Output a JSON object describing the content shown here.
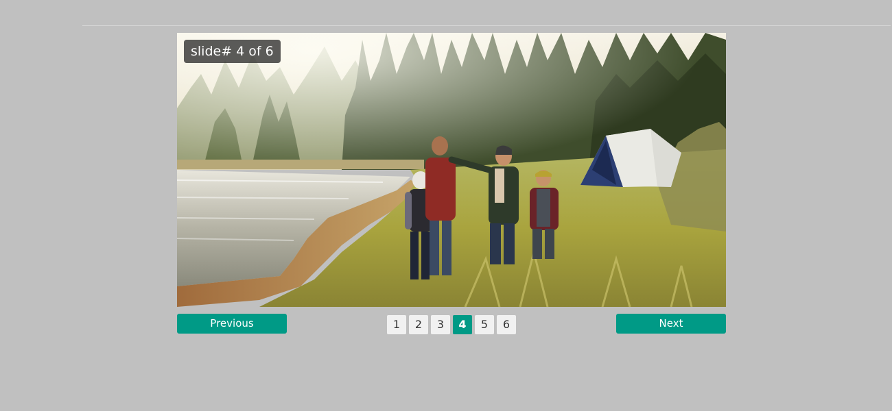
{
  "colors": {
    "accent": "#009a86",
    "page_bg": "#c0c0c0",
    "counter_bg": "#2d2d2d",
    "page_button_bg": "#f1f1f1"
  },
  "slideshow": {
    "counter": "slide# 4 of 6",
    "current_page": 4,
    "image_subject": "family-hiking-by-lake-with-tent"
  },
  "navigation": {
    "previous_label": "Previous",
    "next_label": "Next"
  },
  "pager": {
    "pages": [
      "1",
      "2",
      "3",
      "4",
      "5",
      "6"
    ],
    "active": "4"
  }
}
